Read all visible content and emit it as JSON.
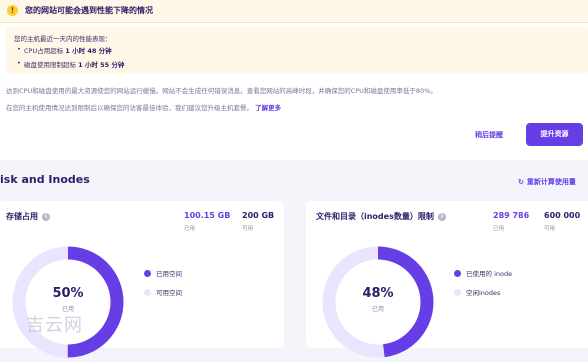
{
  "alert": {
    "title": "您的网站可能会遇到性能下降的情况",
    "perf_intro": "您的主机最近一天内的性能表现：",
    "cpu_prefix": "CPU占用超标",
    "cpu_value": "1 小时 48 分钟",
    "disk_prefix": "磁盘使用限制超标",
    "disk_value": "1 小时 55 分钟",
    "desc1": "达到CPU和磁盘使用的最大资源使您的网站运行缓慢。网站不会生成任何错误消息。查看您网站的高峰时段，并确保您的CPU和磁盘使用率低于80%。",
    "desc2": "在您的主机使用情况达到限制后以确保您的访客最佳体验，我们建议您升级主机套餐。",
    "learn_more": "了解更多",
    "remind_label": "稍后提醒",
    "upgrade_label": "提升资源"
  },
  "section": {
    "title": "isk and Inodes",
    "recalc_label": "重新计算使用量"
  },
  "storage": {
    "title": "存储占用",
    "used_value": "100.15 GB",
    "used_label": "已用",
    "available_value": "200 GB",
    "available_label": "可用",
    "percent": "50%",
    "percent_label": "已用",
    "used_fraction": 0.5,
    "legend_used": "已用空间",
    "legend_available": "可用空间"
  },
  "inodes": {
    "title": "文件和目录（inodes数量）限制",
    "used_value": "289 786",
    "used_label": "已用",
    "available_value": "600 000",
    "available_label": "可用",
    "percent": "48%",
    "percent_label": "已用",
    "used_fraction": 0.48,
    "legend_used": "已使用的 inode",
    "legend_available": "空闲inodes"
  },
  "colors": {
    "accent": "#673de6",
    "track": "#ebe4ff",
    "warning": "#ffcd35"
  },
  "watermark": "吉云网"
}
